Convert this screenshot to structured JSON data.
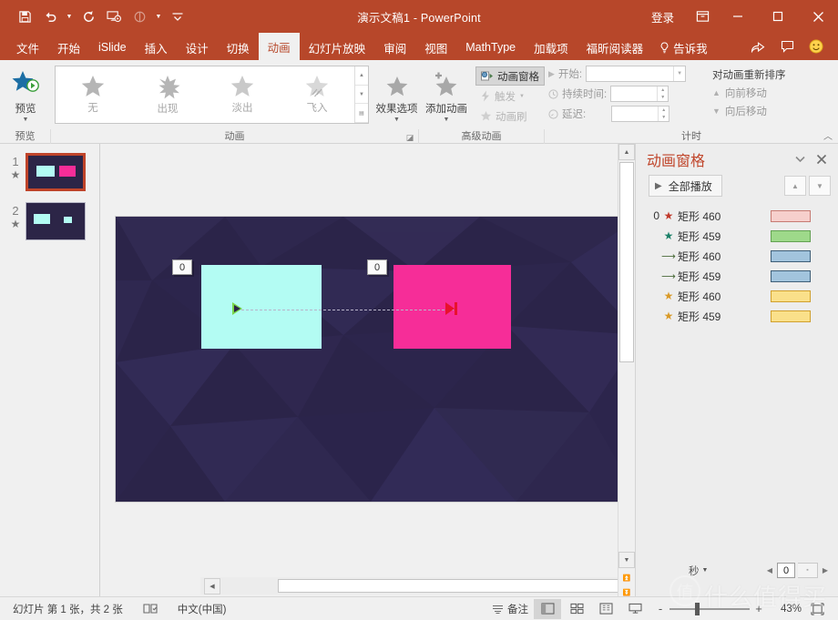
{
  "titlebar": {
    "document_title": "演示文稿1  -  PowerPoint",
    "signin": "登录",
    "qat": [
      {
        "name": "save-icon",
        "label": "保存"
      },
      {
        "name": "undo-icon",
        "label": "撤消"
      },
      {
        "name": "redo-icon",
        "label": "恢复"
      },
      {
        "name": "start-slideshow-icon",
        "label": "从头开始"
      },
      {
        "name": "touch-mode-icon",
        "label": "触摸模式"
      },
      {
        "name": "customize-qat-icon",
        "label": "自定义快速访问工具栏"
      }
    ],
    "window_buttons": [
      "minimize",
      "maximize",
      "close"
    ],
    "ribbon_display_icon": "ribbon-display-options-icon"
  },
  "tabs": [
    {
      "label": "文件",
      "active": false
    },
    {
      "label": "开始",
      "active": false
    },
    {
      "label": "iSlide",
      "active": false
    },
    {
      "label": "插入",
      "active": false
    },
    {
      "label": "设计",
      "active": false
    },
    {
      "label": "切换",
      "active": false
    },
    {
      "label": "动画",
      "active": true
    },
    {
      "label": "幻灯片放映",
      "active": false
    },
    {
      "label": "审阅",
      "active": false
    },
    {
      "label": "视图",
      "active": false
    },
    {
      "label": "MathType",
      "active": false
    },
    {
      "label": "加载项",
      "active": false
    },
    {
      "label": "福昕阅读器",
      "active": false
    }
  ],
  "tellme": "告诉我",
  "tab_right_icons": [
    "share-icon",
    "comment-icon",
    "smiley-icon"
  ],
  "ribbon": {
    "groups": [
      {
        "label": "预览"
      },
      {
        "label": "动画"
      },
      {
        "label": "高级动画"
      },
      {
        "label": "计时"
      }
    ],
    "preview": {
      "label": "预览"
    },
    "gallery": [
      {
        "label": "无",
        "icon": "star-none-icon"
      },
      {
        "label": "出现",
        "icon": "star-appear-icon"
      },
      {
        "label": "淡出",
        "icon": "star-fade-icon"
      },
      {
        "label": "飞入",
        "icon": "star-flyin-icon"
      }
    ],
    "effect_options": {
      "label": "效果选项"
    },
    "add_animation": {
      "label": "添加动画"
    },
    "animation_pane_btn": {
      "label": "动画窗格",
      "active": true
    },
    "trigger_btn": {
      "label": "触发"
    },
    "animation_painter_btn": {
      "label": "动画刷"
    },
    "timing": {
      "start_label": "开始:",
      "start_value": "",
      "duration_label": "持续时间:",
      "duration_value": "",
      "delay_label": "延迟:",
      "delay_value": ""
    },
    "reorder": {
      "title": "对动画重新排序",
      "move_earlier": "向前移动",
      "move_later": "向后移动"
    }
  },
  "thumbnails": [
    {
      "number": "1",
      "selected": true,
      "star": "★"
    },
    {
      "number": "2",
      "selected": false,
      "star": "★"
    }
  ],
  "slide": {
    "shapes": [
      {
        "name": "rect-cyan",
        "color": "#b3fcf3",
        "tag": "0"
      },
      {
        "name": "rect-pink",
        "color": "#f62d98",
        "tag": "0"
      }
    ],
    "background_color": "#2b2449",
    "motion_path": {
      "start_marker": "green-play-triangle",
      "end_marker": "red-end-marker"
    }
  },
  "animation_pane": {
    "title": "动画窗格",
    "collapse_icon": "chevron-down-icon",
    "close_icon": "close-icon",
    "play_all": "全部播放",
    "move_up_icon": "move-up-icon",
    "move_down_icon": "move-down-icon",
    "items": [
      {
        "index": "0",
        "icon": "★",
        "icon_color": "#c0392b",
        "name": "矩形 460",
        "bar_fill": "#f6cfcc",
        "bar_border": "#c77b73"
      },
      {
        "index": "",
        "icon": "★",
        "icon_color": "#1b8068",
        "name": "矩形 459",
        "bar_fill": "#9ed98a",
        "bar_border": "#63a152"
      },
      {
        "index": "",
        "icon": "⟶",
        "icon_color": "#4a6b3a",
        "name": "矩形 460",
        "bar_fill": "#a2c4dd",
        "bar_border": "#3f5f78"
      },
      {
        "index": "",
        "icon": "⟶",
        "icon_color": "#4a6b3a",
        "name": "矩形 459",
        "bar_fill": "#a2c4dd",
        "bar_border": "#3f5f78"
      },
      {
        "index": "",
        "icon": "★",
        "icon_color": "#d99a28",
        "name": "矩形 460",
        "bar_fill": "#fae08a",
        "bar_border": "#d0a02e"
      },
      {
        "index": "",
        "icon": "★",
        "icon_color": "#d99a28",
        "name": "矩形 459",
        "bar_fill": "#fae08a",
        "bar_border": "#d0a02e"
      }
    ],
    "seconds_label": "秒",
    "seconds_value": "0"
  },
  "statusbar": {
    "slide_info": "幻灯片 第 1 张，共 2 张",
    "language": "中文(中国)",
    "notes_label": "备注",
    "views": [
      {
        "name": "normal-view",
        "active": true
      },
      {
        "name": "slide-sorter-view",
        "active": false
      },
      {
        "name": "reading-view",
        "active": false
      },
      {
        "name": "slideshow-view",
        "active": false
      }
    ],
    "zoom_out": "-",
    "zoom_in": "+",
    "zoom_percent": "43%",
    "fit_icon": "fit-slide-icon"
  },
  "watermark": {
    "mark": "值",
    "text": "什么值得买"
  }
}
